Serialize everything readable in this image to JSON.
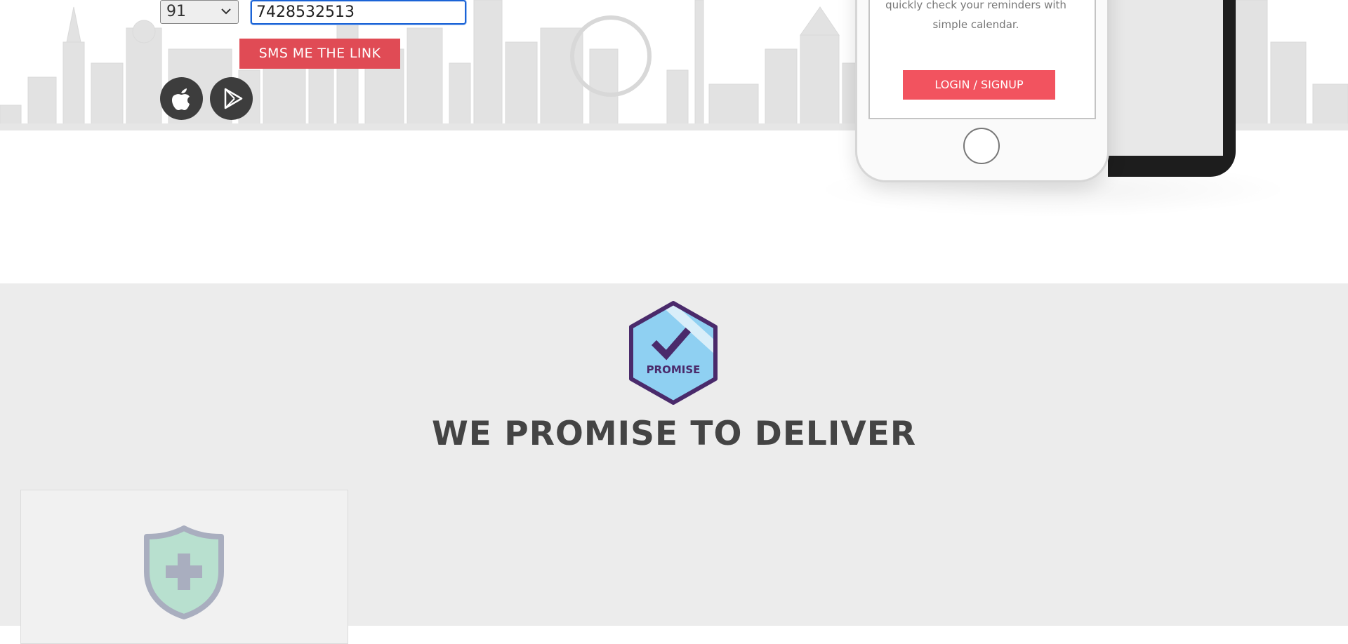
{
  "sms_form": {
    "country_code": "91",
    "phone_value": "7428532513",
    "sms_button_label": "SMS ME THE LINK"
  },
  "store_icons": {
    "apple": "apple-icon",
    "google_play": "google-play-icon"
  },
  "phone_mockup": {
    "screen_text": "quickly check your reminders with simple calendar.",
    "login_label": "LOGIN / SIGNUP"
  },
  "promise": {
    "badge_text": "PROMISE",
    "heading": "WE PROMISE TO DELIVER"
  },
  "colors": {
    "accent_red": "#e04b55",
    "login_red": "#f2535f",
    "badge_purple": "#4a2a6b",
    "badge_blue": "#8fd0f2",
    "section_gray": "#ececec"
  }
}
